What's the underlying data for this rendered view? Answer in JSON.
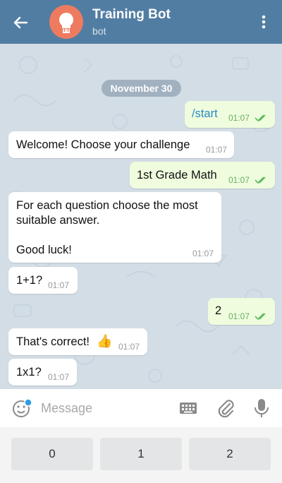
{
  "header": {
    "title": "Training Bot",
    "subtitle": "bot",
    "color": "#517da2",
    "avatar_color": "#ee7b5f",
    "back_icon": "arrow-left-icon",
    "menu_icon": "more-vertical-icon",
    "avatar_icon": "lightbulb-icon"
  },
  "chat": {
    "date_chip": "November 30",
    "messages": [
      {
        "direction": "out",
        "text": "/start",
        "time": "01:07",
        "status": "read"
      },
      {
        "direction": "in",
        "text": "Welcome! Choose your challenge",
        "time": "01:07"
      },
      {
        "direction": "out",
        "text": "1st Grade Math",
        "time": "01:07",
        "status": "read"
      },
      {
        "direction": "in",
        "lines": [
          "For each question choose the most",
          "suitable answer.",
          "",
          "Good luck!"
        ],
        "time": "01:07"
      },
      {
        "direction": "in",
        "text": "1+1?",
        "time": "01:07"
      },
      {
        "direction": "out",
        "text": "2",
        "time": "01:07",
        "status": "read"
      },
      {
        "direction": "in",
        "text": "That's correct!",
        "emoji": "👍",
        "time": "01:07"
      },
      {
        "direction": "in",
        "text": "1x1?",
        "time": "01:07"
      }
    ]
  },
  "input": {
    "placeholder": "Message",
    "icons": [
      "emoji-icon",
      "keyboard-icon",
      "paperclip-icon",
      "microphone-icon"
    ]
  },
  "bot_keyboard": {
    "buttons": [
      "0",
      "1",
      "2"
    ]
  }
}
